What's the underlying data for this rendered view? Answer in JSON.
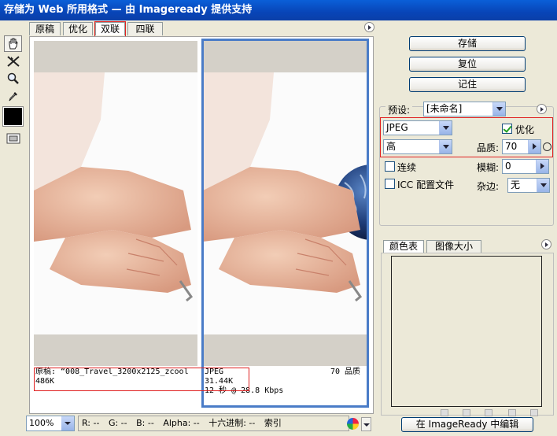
{
  "window": {
    "title": "存储为 Web 所用格式 — 由 Imageready 提供支持"
  },
  "tools": {
    "hand": "hand-icon",
    "slice_select": "slice-select-icon",
    "zoom": "zoom-icon",
    "eyedropper": "eyedropper-icon",
    "color_swatch": "#000000",
    "toggle_preview": "preview-toggle-icon"
  },
  "tabs": [
    "原稿",
    "优化",
    "双联",
    "四联"
  ],
  "active_tab": "双联",
  "panes": {
    "original": {
      "line1": "原稿: “008_Travel_3200x2125_zcool",
      "line2": "486K"
    },
    "optimized": {
      "format": "JPEG",
      "quality": "70 品质",
      "size": "31.44K",
      "time": "12 秒 @ 28.8 Kbps"
    }
  },
  "status": {
    "zoom": "100%",
    "r": "R:   --",
    "g": "G:   --",
    "b": "B:   --",
    "alpha": "Alpha:   --",
    "hex": "十六进制:   --",
    "index": "索引"
  },
  "buttons": {
    "save": "存储",
    "reset": "复位",
    "remember": "记住",
    "edit_in_imageready": "在 ImageReady 中编辑"
  },
  "settings": {
    "preset_label": "预设:",
    "preset_value": "[未命名]",
    "format": "JPEG",
    "optimized_label": "优化",
    "optimized_checked": true,
    "quality_level": "高",
    "quality_label": "品质:",
    "quality_value": "70",
    "progressive_label": "连续",
    "progressive_checked": false,
    "blur_label": "模糊:",
    "blur_value": "0",
    "icc_label": "ICC 配置文件",
    "icc_checked": false,
    "matte_label": "杂边:",
    "matte_value": "无"
  },
  "color_panel": {
    "tabs": [
      "颜色表",
      "图像大小"
    ],
    "active": "颜色表"
  },
  "colors": {
    "title_bar": "#0a4fc8",
    "highlight": "#e02020",
    "pane_outline": "#4a7cc7",
    "dialog_bg": "#ece9d8"
  }
}
